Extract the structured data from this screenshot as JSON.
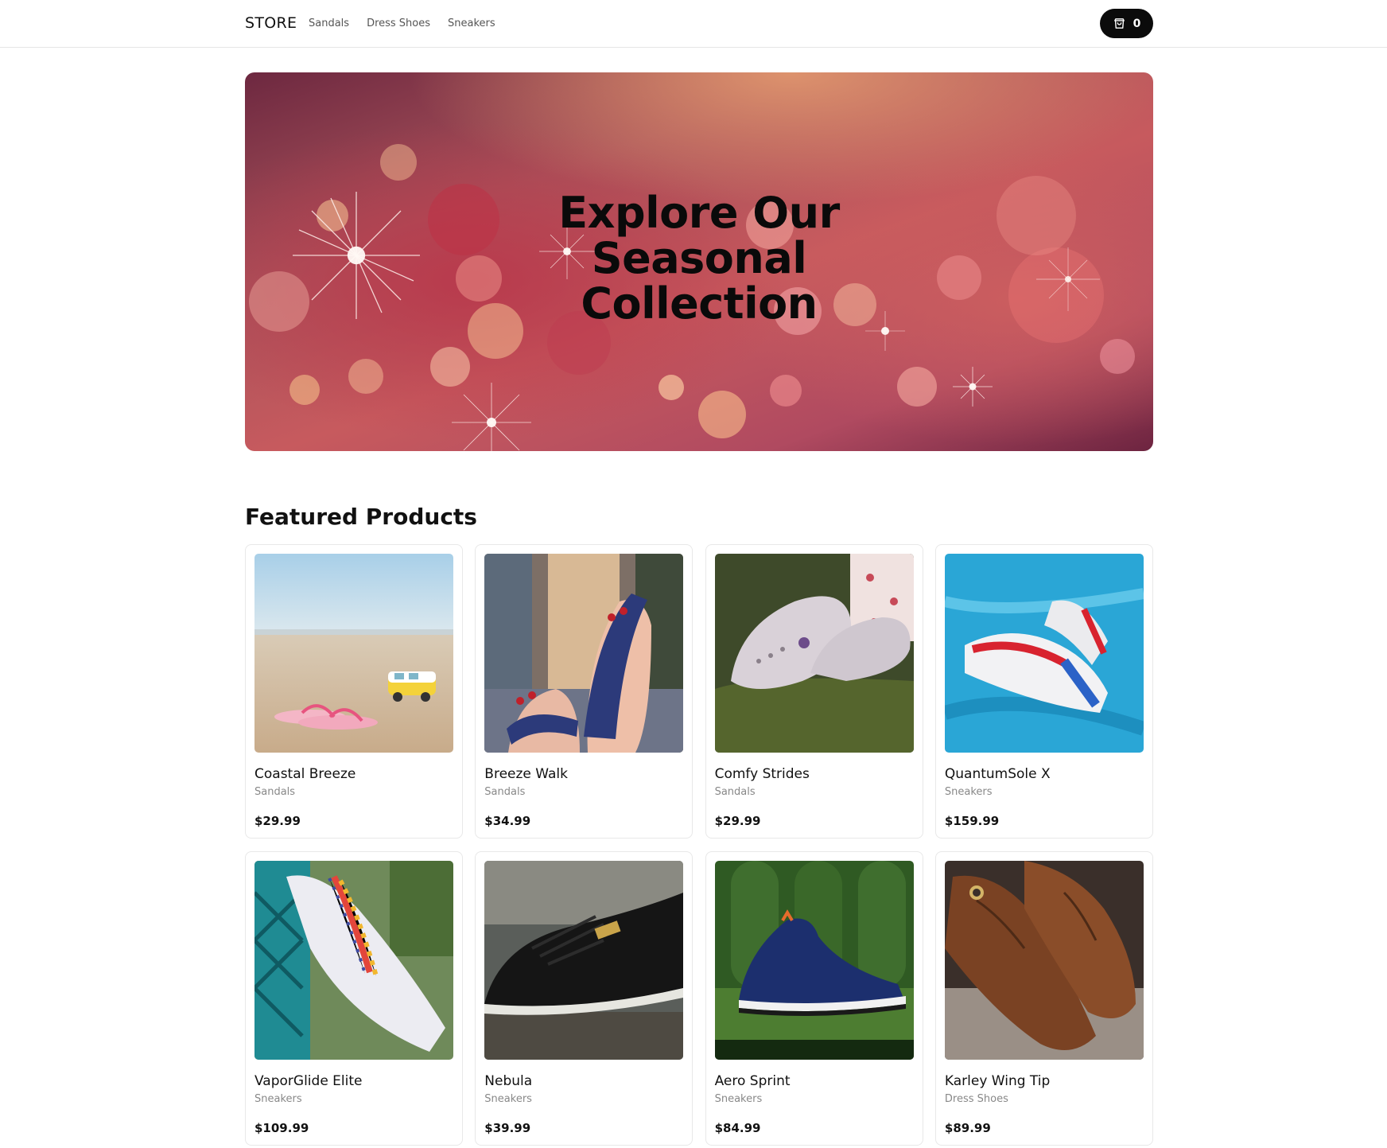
{
  "header": {
    "logo": "STORE",
    "nav": [
      "Sandals",
      "Dress Shoes",
      "Sneakers"
    ],
    "cart_icon": "shopping-bag-icon",
    "cart_count": "0"
  },
  "hero": {
    "title_lines": [
      "Explore Our",
      "Seasonal",
      "Collection"
    ]
  },
  "featured": {
    "title": "Featured Products",
    "products": [
      {
        "name": "Coastal Breeze",
        "category": "Sandals",
        "price": "$29.99"
      },
      {
        "name": "Breeze Walk",
        "category": "Sandals",
        "price": "$34.99"
      },
      {
        "name": "Comfy Strides",
        "category": "Sandals",
        "price": "$29.99"
      },
      {
        "name": "QuantumSole X",
        "category": "Sneakers",
        "price": "$159.99"
      },
      {
        "name": "VaporGlide Elite",
        "category": "Sneakers",
        "price": "$109.99"
      },
      {
        "name": "Nebula",
        "category": "Sneakers",
        "price": "$39.99"
      },
      {
        "name": "Aero Sprint",
        "category": "Sneakers",
        "price": "$84.99"
      },
      {
        "name": "Karley Wing Tip",
        "category": "Dress Shoes",
        "price": "$89.99"
      }
    ]
  }
}
